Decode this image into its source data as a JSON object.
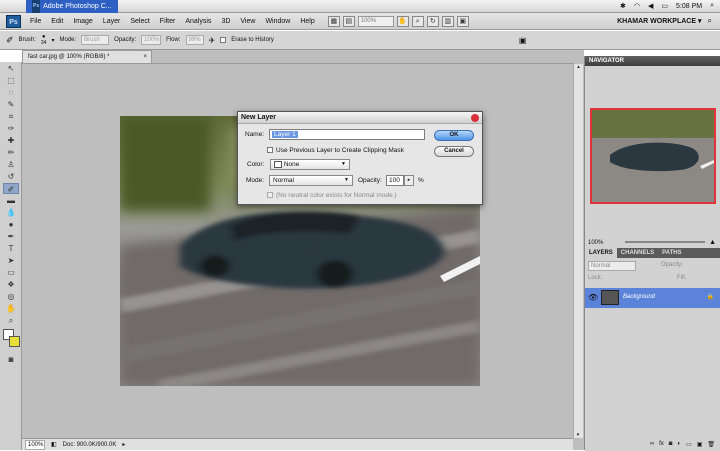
{
  "mac_menubar": {
    "app_label": "Adobe Photoshop C...",
    "clock": "5:08 PM"
  },
  "app_bar": {
    "logo": "Ps",
    "menus": [
      "File",
      "Edit",
      "Image",
      "Layer",
      "Select",
      "Filter",
      "Analysis",
      "3D",
      "View",
      "Window",
      "Help"
    ],
    "zoom_value": "100%",
    "workspace": "KHAMAR WORKPLACE"
  },
  "options_bar": {
    "brush_label": "Brush:",
    "brush_size": "34",
    "mode_label": "Mode:",
    "mode_value": "Brush",
    "opacity_label": "Opacity:",
    "opacity_value": "100%",
    "flow_label": "Flow:",
    "flow_value": "99%",
    "erase_label": "Erase to History"
  },
  "document": {
    "tab_title": "fast car.jpg @ 100% (RGB/8) *",
    "status_zoom": "100%",
    "status_doc": "Doc: 900.0K/900.0K"
  },
  "navigator": {
    "title": "NAVIGATOR",
    "zoom": "100%"
  },
  "layers_panel": {
    "tabs": [
      "LAYERS",
      "CHANNELS",
      "PATHS"
    ],
    "blend_mode": "Normal",
    "opacity_label": "Opacity:",
    "fill_label": "Fill:",
    "lock_label": "Lock:",
    "layers": [
      {
        "name": "Background"
      }
    ]
  },
  "dialog": {
    "title": "New Layer",
    "name_label": "Name:",
    "name_value": "Layer 1",
    "clipping_label": "Use Previous Layer to Create Clipping Mask",
    "color_label": "Color:",
    "color_value": "None",
    "mode_label": "Mode:",
    "mode_value": "Normal",
    "opacity_label": "Opacity:",
    "opacity_value": "100",
    "percent": "%",
    "neutral_label": "(No neutral color exists for Normal mode.)",
    "ok_label": "OK",
    "cancel_label": "Cancel"
  }
}
